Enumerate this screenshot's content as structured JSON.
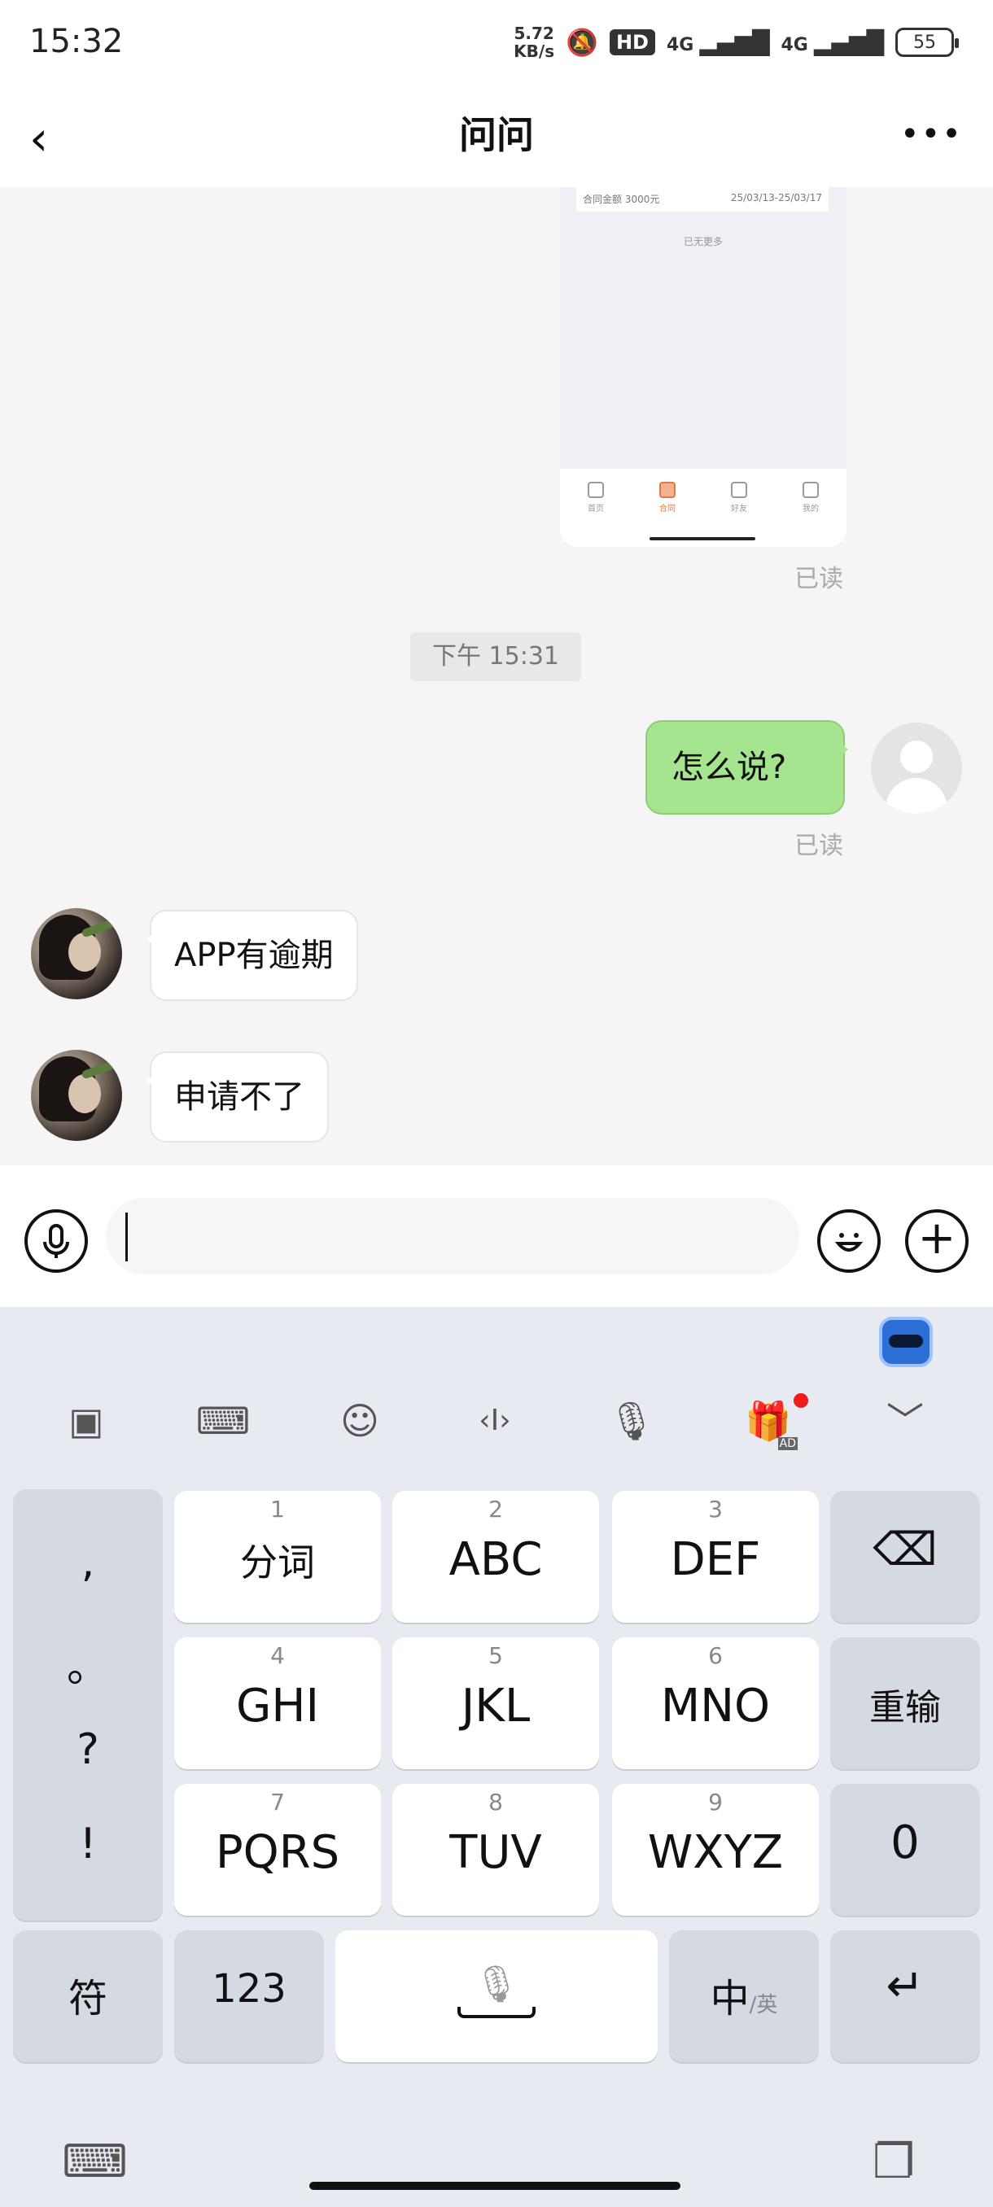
{
  "status_bar": {
    "time": "15:32",
    "net_speed_value": "5.72",
    "net_speed_unit": "KB/s",
    "hd_label": "HD",
    "network_1": "4G",
    "network_2": "4G",
    "battery": "55"
  },
  "nav": {
    "title": "问问",
    "back_icon": "‹",
    "more_icon": "•••"
  },
  "chat": {
    "shared_screenshot": {
      "card_amount_label": "合同金额 3000元",
      "card_dates": "25/03/13-25/03/17",
      "see_more": "已无更多",
      "tabs": [
        "首页",
        "合同",
        "好友",
        "我的"
      ],
      "active_tab": 1
    },
    "read_receipt_1": "已读",
    "time_divider": "下午 15:31",
    "outgoing_message": "怎么说?",
    "read_receipt_2": "已读",
    "incoming_messages": [
      "APP有逾期",
      "申请不了"
    ]
  },
  "input_bar": {
    "text_value": "",
    "plus_icon": "+"
  },
  "keyboard": {
    "toolbar_icons": [
      "apps-grid-icon",
      "keyboard-layout-icon",
      "emoji-icon",
      "cursor-move-icon",
      "voice-input-icon",
      "ad-gift-icon",
      "collapse-icon"
    ],
    "toolbar_glyphs": [
      "▣",
      "⌨",
      "☺",
      "‹I›",
      "🎙",
      "🎁",
      "﹀"
    ],
    "ad_label": "AD",
    "punctuation": [
      ",",
      "。",
      "?",
      "!"
    ],
    "keys": [
      {
        "num": "1",
        "label": "分词"
      },
      {
        "num": "2",
        "label": "ABC"
      },
      {
        "num": "3",
        "label": "DEF"
      },
      {
        "num": "4",
        "label": "GHI"
      },
      {
        "num": "5",
        "label": "JKL"
      },
      {
        "num": "6",
        "label": "MNO"
      },
      {
        "num": "7",
        "label": "PQRS"
      },
      {
        "num": "8",
        "label": "TUV"
      },
      {
        "num": "9",
        "label": "WXYZ"
      }
    ],
    "delete_icon": "⌫",
    "retype_label": "重输",
    "zero_label": "0",
    "symbol_label": "符",
    "num_label": "123",
    "lang_main": "中",
    "lang_alt": "/英",
    "enter_icon": "↵",
    "switch_keyboard_icon": "⌨",
    "clipboard_icon": "❐"
  }
}
